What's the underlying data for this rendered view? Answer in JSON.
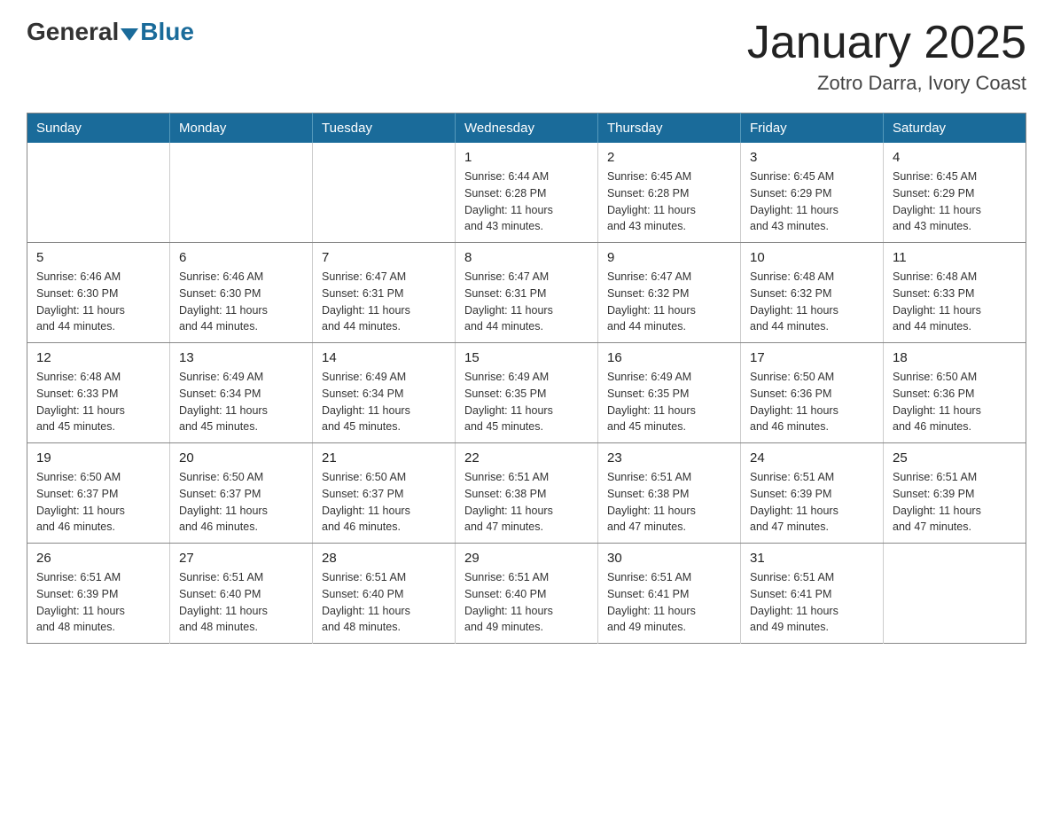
{
  "header": {
    "logo_general": "General",
    "logo_blue": "Blue",
    "month_title": "January 2025",
    "location": "Zotro Darra, Ivory Coast"
  },
  "calendar": {
    "days_of_week": [
      "Sunday",
      "Monday",
      "Tuesday",
      "Wednesday",
      "Thursday",
      "Friday",
      "Saturday"
    ],
    "weeks": [
      [
        {
          "day": "",
          "info": ""
        },
        {
          "day": "",
          "info": ""
        },
        {
          "day": "",
          "info": ""
        },
        {
          "day": "1",
          "info": "Sunrise: 6:44 AM\nSunset: 6:28 PM\nDaylight: 11 hours\nand 43 minutes."
        },
        {
          "day": "2",
          "info": "Sunrise: 6:45 AM\nSunset: 6:28 PM\nDaylight: 11 hours\nand 43 minutes."
        },
        {
          "day": "3",
          "info": "Sunrise: 6:45 AM\nSunset: 6:29 PM\nDaylight: 11 hours\nand 43 minutes."
        },
        {
          "day": "4",
          "info": "Sunrise: 6:45 AM\nSunset: 6:29 PM\nDaylight: 11 hours\nand 43 minutes."
        }
      ],
      [
        {
          "day": "5",
          "info": "Sunrise: 6:46 AM\nSunset: 6:30 PM\nDaylight: 11 hours\nand 44 minutes."
        },
        {
          "day": "6",
          "info": "Sunrise: 6:46 AM\nSunset: 6:30 PM\nDaylight: 11 hours\nand 44 minutes."
        },
        {
          "day": "7",
          "info": "Sunrise: 6:47 AM\nSunset: 6:31 PM\nDaylight: 11 hours\nand 44 minutes."
        },
        {
          "day": "8",
          "info": "Sunrise: 6:47 AM\nSunset: 6:31 PM\nDaylight: 11 hours\nand 44 minutes."
        },
        {
          "day": "9",
          "info": "Sunrise: 6:47 AM\nSunset: 6:32 PM\nDaylight: 11 hours\nand 44 minutes."
        },
        {
          "day": "10",
          "info": "Sunrise: 6:48 AM\nSunset: 6:32 PM\nDaylight: 11 hours\nand 44 minutes."
        },
        {
          "day": "11",
          "info": "Sunrise: 6:48 AM\nSunset: 6:33 PM\nDaylight: 11 hours\nand 44 minutes."
        }
      ],
      [
        {
          "day": "12",
          "info": "Sunrise: 6:48 AM\nSunset: 6:33 PM\nDaylight: 11 hours\nand 45 minutes."
        },
        {
          "day": "13",
          "info": "Sunrise: 6:49 AM\nSunset: 6:34 PM\nDaylight: 11 hours\nand 45 minutes."
        },
        {
          "day": "14",
          "info": "Sunrise: 6:49 AM\nSunset: 6:34 PM\nDaylight: 11 hours\nand 45 minutes."
        },
        {
          "day": "15",
          "info": "Sunrise: 6:49 AM\nSunset: 6:35 PM\nDaylight: 11 hours\nand 45 minutes."
        },
        {
          "day": "16",
          "info": "Sunrise: 6:49 AM\nSunset: 6:35 PM\nDaylight: 11 hours\nand 45 minutes."
        },
        {
          "day": "17",
          "info": "Sunrise: 6:50 AM\nSunset: 6:36 PM\nDaylight: 11 hours\nand 46 minutes."
        },
        {
          "day": "18",
          "info": "Sunrise: 6:50 AM\nSunset: 6:36 PM\nDaylight: 11 hours\nand 46 minutes."
        }
      ],
      [
        {
          "day": "19",
          "info": "Sunrise: 6:50 AM\nSunset: 6:37 PM\nDaylight: 11 hours\nand 46 minutes."
        },
        {
          "day": "20",
          "info": "Sunrise: 6:50 AM\nSunset: 6:37 PM\nDaylight: 11 hours\nand 46 minutes."
        },
        {
          "day": "21",
          "info": "Sunrise: 6:50 AM\nSunset: 6:37 PM\nDaylight: 11 hours\nand 46 minutes."
        },
        {
          "day": "22",
          "info": "Sunrise: 6:51 AM\nSunset: 6:38 PM\nDaylight: 11 hours\nand 47 minutes."
        },
        {
          "day": "23",
          "info": "Sunrise: 6:51 AM\nSunset: 6:38 PM\nDaylight: 11 hours\nand 47 minutes."
        },
        {
          "day": "24",
          "info": "Sunrise: 6:51 AM\nSunset: 6:39 PM\nDaylight: 11 hours\nand 47 minutes."
        },
        {
          "day": "25",
          "info": "Sunrise: 6:51 AM\nSunset: 6:39 PM\nDaylight: 11 hours\nand 47 minutes."
        }
      ],
      [
        {
          "day": "26",
          "info": "Sunrise: 6:51 AM\nSunset: 6:39 PM\nDaylight: 11 hours\nand 48 minutes."
        },
        {
          "day": "27",
          "info": "Sunrise: 6:51 AM\nSunset: 6:40 PM\nDaylight: 11 hours\nand 48 minutes."
        },
        {
          "day": "28",
          "info": "Sunrise: 6:51 AM\nSunset: 6:40 PM\nDaylight: 11 hours\nand 48 minutes."
        },
        {
          "day": "29",
          "info": "Sunrise: 6:51 AM\nSunset: 6:40 PM\nDaylight: 11 hours\nand 49 minutes."
        },
        {
          "day": "30",
          "info": "Sunrise: 6:51 AM\nSunset: 6:41 PM\nDaylight: 11 hours\nand 49 minutes."
        },
        {
          "day": "31",
          "info": "Sunrise: 6:51 AM\nSunset: 6:41 PM\nDaylight: 11 hours\nand 49 minutes."
        },
        {
          "day": "",
          "info": ""
        }
      ]
    ]
  }
}
